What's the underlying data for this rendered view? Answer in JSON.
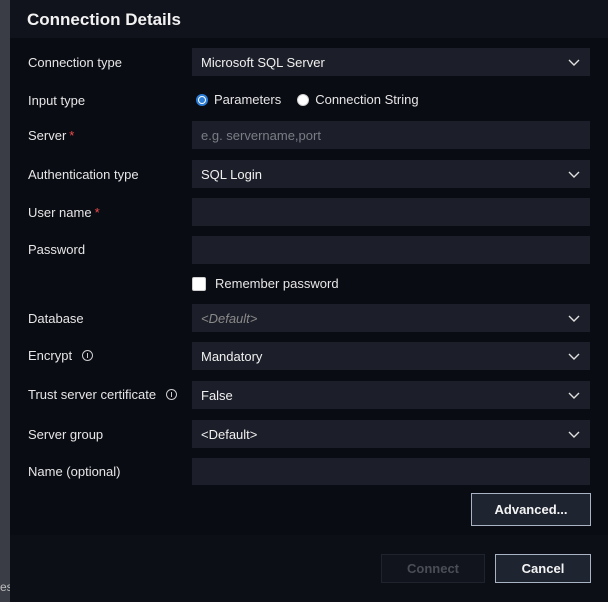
{
  "left_strip_text": "es",
  "title": "Connection Details",
  "labels": {
    "connection_type": "Connection type",
    "input_type": "Input type",
    "server": "Server",
    "authentication_type": "Authentication type",
    "user_name": "User name",
    "password": "Password",
    "database": "Database",
    "encrypt": "Encrypt",
    "trust_server_certificate": "Trust server certificate",
    "server_group": "Server group",
    "name": "Name (optional)"
  },
  "required_marker": "*",
  "fields": {
    "connection_type": "Microsoft SQL Server",
    "server_placeholder": "e.g. servername,port",
    "authentication_type": "SQL Login",
    "user_name": "",
    "password": "",
    "database": "<Default>",
    "encrypt": "Mandatory",
    "trust_server_certificate": "False",
    "server_group": "<Default>",
    "name": ""
  },
  "input_type_options": {
    "parameters": "Parameters",
    "connection_string": "Connection String",
    "selected": "parameters"
  },
  "remember_password": {
    "label": "Remember password",
    "checked": false
  },
  "buttons": {
    "advanced": "Advanced...",
    "connect": "Connect",
    "cancel": "Cancel"
  },
  "colors": {
    "accent": "#2a7cd6",
    "required": "#f14c4c",
    "background": "#0a0c14",
    "field_background": "#1c1f29"
  },
  "icons": {
    "dropdown": "chevron-down-icon",
    "info": "info-icon"
  }
}
